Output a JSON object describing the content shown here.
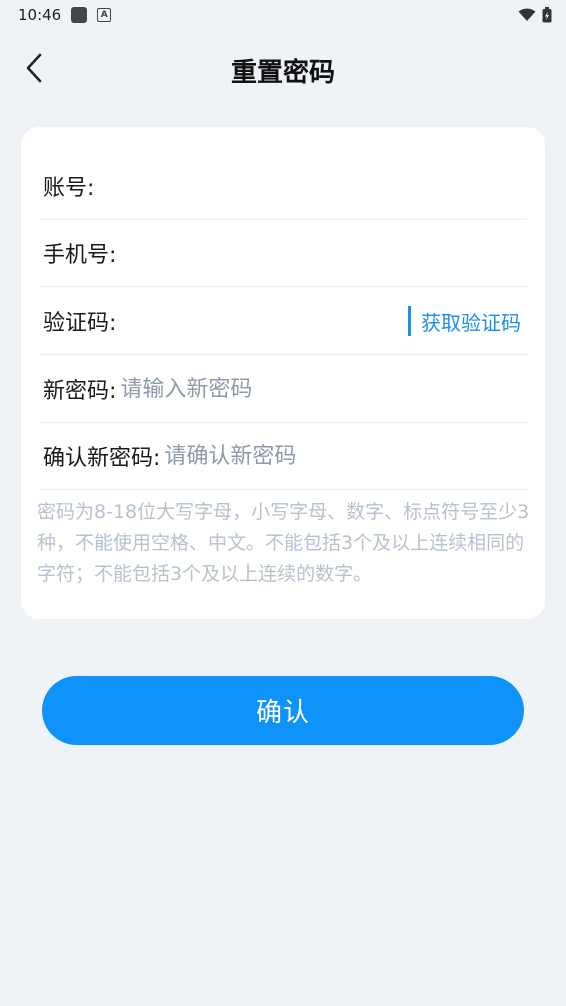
{
  "status_bar": {
    "time": "10:46"
  },
  "header": {
    "title": "重置密码"
  },
  "form": {
    "account_label": "账号:",
    "phone_label": "手机号:",
    "code_label": "验证码:",
    "get_code_label": "获取验证码",
    "new_password_label": "新密码:",
    "new_password_placeholder": "请输入新密码",
    "confirm_password_label": "确认新密码:",
    "confirm_password_placeholder": "请确认新密码",
    "hint": "密码为8-18位大写字母，小写字母、数字、标点符号至少3种，不能使用空格、中文。不能包括3个及以上连续相同的字符；不能包括3个及以上连续的数字。"
  },
  "actions": {
    "confirm_label": "确认"
  },
  "colors": {
    "primary": "#0f93f8",
    "link": "#1b8fe8",
    "background": "#eff3f7",
    "hint": "#b7c2cf"
  }
}
